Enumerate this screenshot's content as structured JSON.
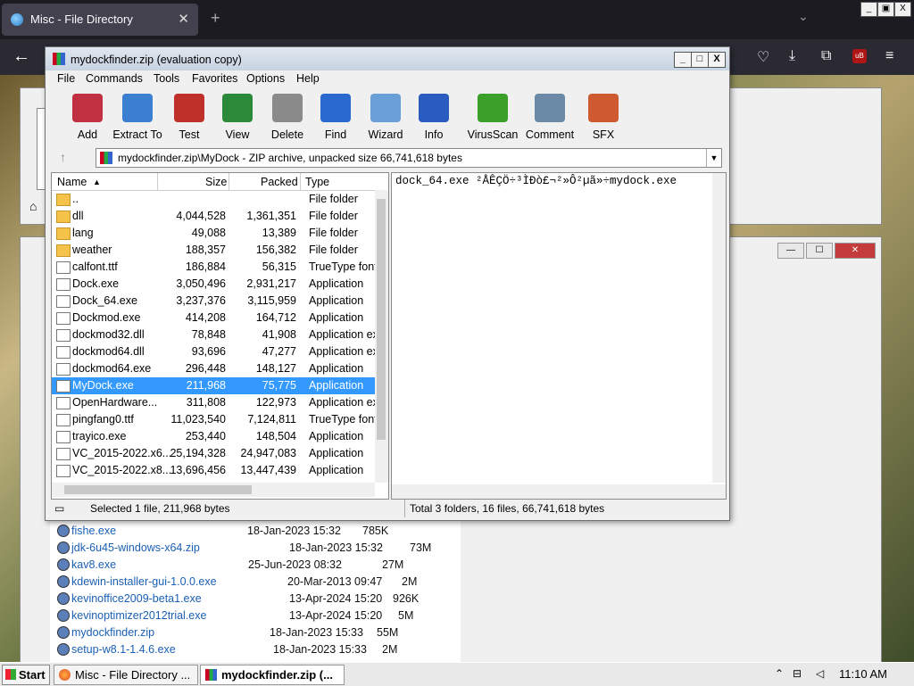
{
  "browser": {
    "tab_title": "Misc - File Directory",
    "tab_close": "✕",
    "new_tab": "+",
    "tab_list": "⌄",
    "min": "_",
    "max": "▣",
    "close": "X"
  },
  "explorer": {
    "min": "—",
    "max": "☐",
    "close": "✕"
  },
  "winrar": {
    "title": "mydockfinder.zip (evaluation copy)",
    "title_min": "_",
    "title_max": "□",
    "title_close": "X",
    "menu": [
      "File",
      "Commands",
      "Tools",
      "Favorites",
      "Options",
      "Help"
    ],
    "toolbar": [
      {
        "label": "Add",
        "color": "#c03040"
      },
      {
        "label": "Extract To",
        "color": "#3a7fd0"
      },
      {
        "label": "Test",
        "color": "#c0302a"
      },
      {
        "label": "View",
        "color": "#2a8a3a"
      },
      {
        "label": "Delete",
        "color": "#8a8a8a"
      },
      {
        "label": "Find",
        "color": "#2a6ad0"
      },
      {
        "label": "Wizard",
        "color": "#6aa0d8"
      },
      {
        "label": "Info",
        "color": "#2a5cc0"
      },
      {
        "label": "VirusScan",
        "color": "#3aa02a"
      },
      {
        "label": "Comment",
        "color": "#6a8aa8"
      },
      {
        "label": "SFX",
        "color": "#d05a30"
      }
    ],
    "path": "mydockfinder.zip\\MyDock - ZIP archive, unpacked size 66,741,618 bytes",
    "columns": {
      "name": "Name",
      "size": "Size",
      "packed": "Packed",
      "type": "Type"
    },
    "files": [
      {
        "name": "..",
        "size": "",
        "packed": "",
        "type": "File folder",
        "kind": "folder"
      },
      {
        "name": "dll",
        "size": "4,044,528",
        "packed": "1,361,351",
        "type": "File folder",
        "kind": "folder"
      },
      {
        "name": "lang",
        "size": "49,088",
        "packed": "13,389",
        "type": "File folder",
        "kind": "folder"
      },
      {
        "name": "weather",
        "size": "188,357",
        "packed": "156,382",
        "type": "File folder",
        "kind": "folder"
      },
      {
        "name": "calfont.ttf",
        "size": "186,884",
        "packed": "56,315",
        "type": "TrueType font",
        "kind": "file"
      },
      {
        "name": "Dock.exe",
        "size": "3,050,496",
        "packed": "2,931,217",
        "type": "Application",
        "kind": "file"
      },
      {
        "name": "Dock_64.exe",
        "size": "3,237,376",
        "packed": "3,115,959",
        "type": "Application",
        "kind": "file"
      },
      {
        "name": "Dockmod.exe",
        "size": "414,208",
        "packed": "164,712",
        "type": "Application",
        "kind": "file"
      },
      {
        "name": "dockmod32.dll",
        "size": "78,848",
        "packed": "41,908",
        "type": "Application ex",
        "kind": "file"
      },
      {
        "name": "dockmod64.dll",
        "size": "93,696",
        "packed": "47,277",
        "type": "Application ex",
        "kind": "file"
      },
      {
        "name": "dockmod64.exe",
        "size": "296,448",
        "packed": "148,127",
        "type": "Application",
        "kind": "file"
      },
      {
        "name": "MyDock.exe",
        "size": "211,968",
        "packed": "75,775",
        "type": "Application",
        "kind": "file",
        "selected": true
      },
      {
        "name": "OpenHardware...",
        "size": "311,808",
        "packed": "122,973",
        "type": "Application ex",
        "kind": "file"
      },
      {
        "name": "pingfang0.ttf",
        "size": "11,023,540",
        "packed": "7,124,811",
        "type": "TrueType font",
        "kind": "file"
      },
      {
        "name": "trayico.exe",
        "size": "253,440",
        "packed": "148,504",
        "type": "Application",
        "kind": "file"
      },
      {
        "name": "VC_2015-2022.x6...",
        "size": "25,194,328",
        "packed": "24,947,083",
        "type": "Application",
        "kind": "file"
      },
      {
        "name": "VC_2015-2022.x8...",
        "size": "13,696,456",
        "packed": "13,447,439",
        "type": "Application",
        "kind": "file"
      }
    ],
    "comment": "dock_64.exe ²ÅÊÇÖ÷³ÌÐò£¬²»Ô²µã»÷mydock.exe",
    "status_left": "Selected 1 file, 211,968 bytes",
    "status_right": "Total 3 folders, 16 files, 66,741,618 bytes"
  },
  "listing": [
    {
      "name": "fishe.exe",
      "date": "18-Jan-2023 15:32",
      "size": "785K"
    },
    {
      "name": "jdk-6u45-windows-x64.zip",
      "date": "18-Jan-2023 15:32",
      "size": "73M"
    },
    {
      "name": "kav8.exe",
      "date": "25-Jun-2023 08:32",
      "size": "27M"
    },
    {
      "name": "kdewin-installer-gui-1.0.0.exe",
      "date": "20-Mar-2013 09:47",
      "size": "2M"
    },
    {
      "name": "kevinoffice2009-beta1.exe",
      "date": "13-Apr-2024 15:20",
      "size": "926K"
    },
    {
      "name": "kevinoptimizer2012trial.exe",
      "date": "13-Apr-2024 15:20",
      "size": "5M"
    },
    {
      "name": "mydockfinder.zip",
      "date": "18-Jan-2023 15:33",
      "size": "55M"
    },
    {
      "name": "setup-w8.1-1.4.6.exe",
      "date": "18-Jan-2023 15:33",
      "size": "2M"
    }
  ],
  "taskbar": {
    "start": "Start",
    "tasks": [
      {
        "label": "Misc - File Directory ...",
        "active": false
      },
      {
        "label": "mydockfinder.zip (...",
        "active": true
      }
    ],
    "clock": "11:10 AM"
  }
}
